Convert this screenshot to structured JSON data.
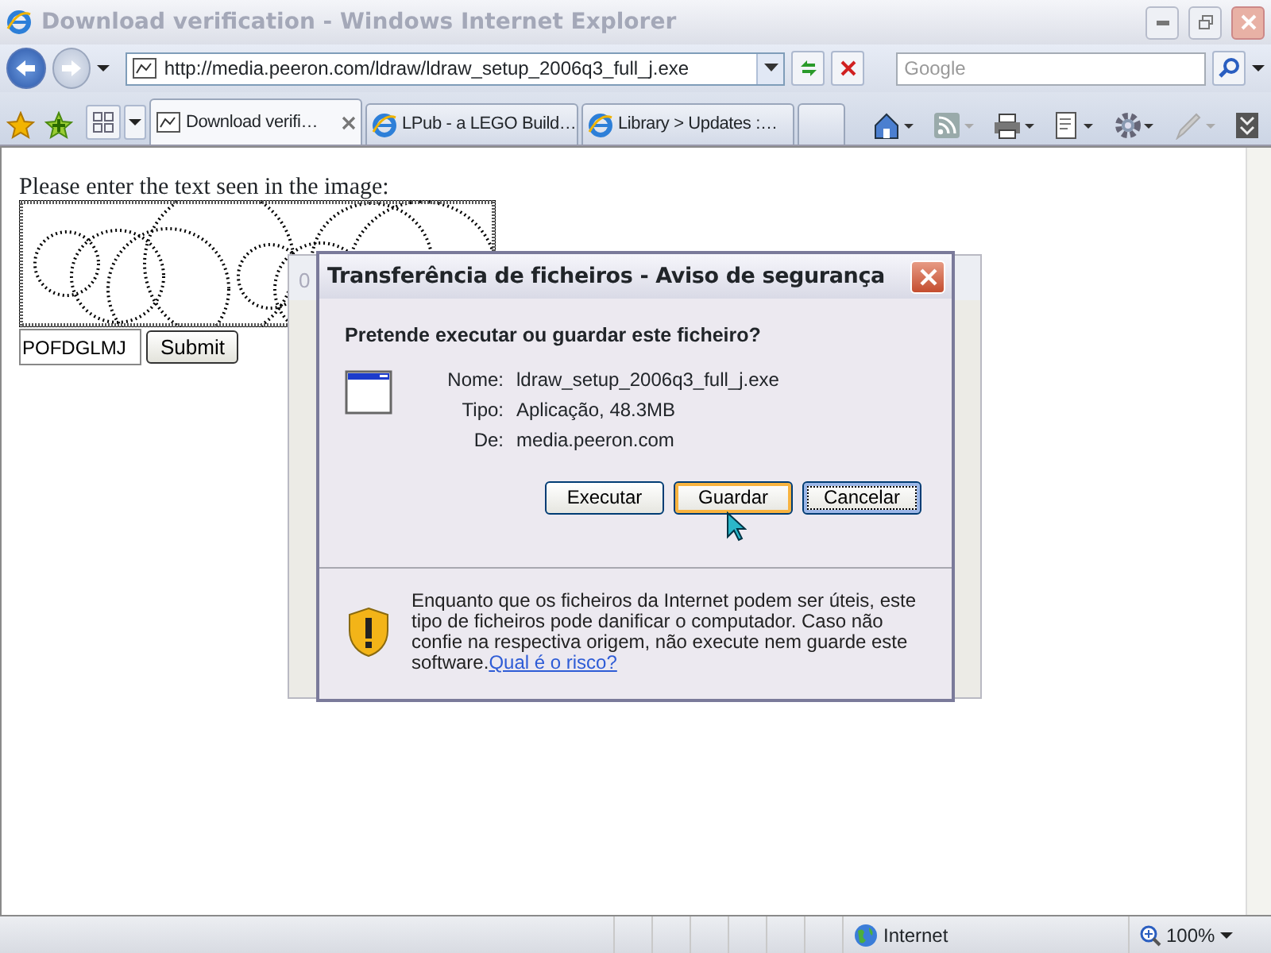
{
  "window": {
    "title": "Download verification - Windows Internet Explorer"
  },
  "address_bar": {
    "url": "http://media.peeron.com/ldraw/ldraw_setup_2006q3_full_j.exe"
  },
  "search": {
    "placeholder": "Google"
  },
  "tabs": [
    {
      "label": "Download verifi…",
      "selected": true
    },
    {
      "label": "LPub - a LEGO Build…",
      "selected": false
    },
    {
      "label": "Library > Updates :…",
      "selected": false
    }
  ],
  "page": {
    "prompt": "Please enter the text seen in the image:",
    "answer": "POFDGLMJ",
    "submit": "Submit"
  },
  "background_dialog": {
    "title": "0"
  },
  "dialog": {
    "title": "Transferência de ficheiros - Aviso de segurança",
    "question": "Pretende executar ou guardar este ficheiro?",
    "fields": [
      {
        "label": "Nome:",
        "value": "ldraw_setup_2006q3_full_j.exe"
      },
      {
        "label": "Tipo:",
        "value": "Aplicação, 48.3MB"
      },
      {
        "label": "De:",
        "value": "media.peeron.com"
      }
    ],
    "buttons": [
      {
        "label": "Executar",
        "hovered": false,
        "focused": false
      },
      {
        "label": "Guardar",
        "hovered": true,
        "focused": false
      },
      {
        "label": "Cancelar",
        "hovered": false,
        "focused": true
      }
    ],
    "warning": {
      "text": "Enquanto que os ficheiros da Internet podem ser úteis, este tipo de ficheiros pode danificar o computador. Caso não confie na respectiva origem, não execute nem guarde este software.",
      "link": "Qual é o risco?"
    }
  },
  "status_bar": {
    "zone": "Internet",
    "zoom": "100%"
  }
}
